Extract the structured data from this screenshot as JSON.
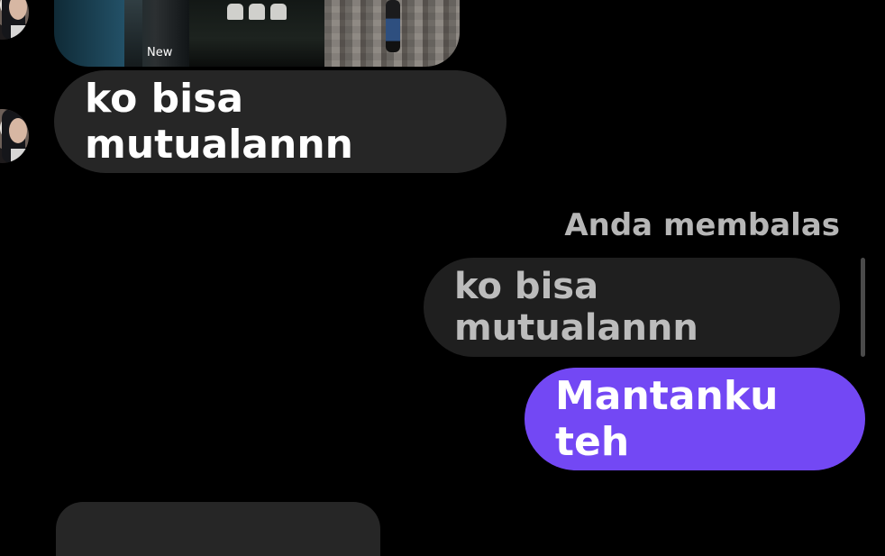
{
  "chat": {
    "story_tiles": [
      {
        "name": "water-photo"
      },
      {
        "name": "shoes-photo",
        "badge": "New"
      },
      {
        "name": "wall-person-photo"
      }
    ],
    "incoming_message": "ko bisa mutualannn",
    "reply_header": "Anda membalas",
    "quoted_message": "ko bisa mutualannn",
    "outgoing_message": "Mantanku teh",
    "outgoing_color": "#7348f4"
  }
}
